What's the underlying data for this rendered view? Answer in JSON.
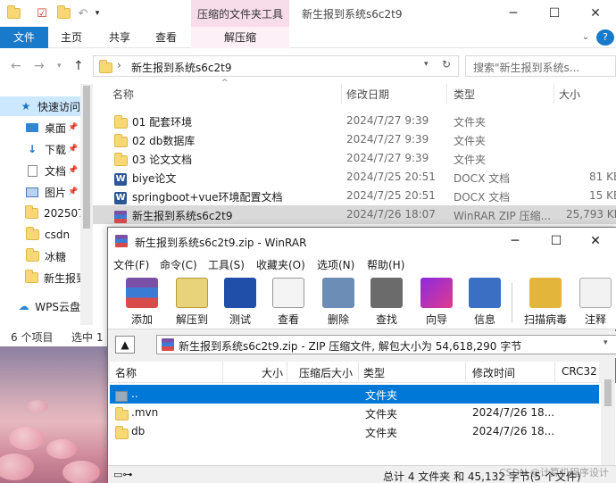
{
  "explorer": {
    "title": "新生报到系统s6c2t9",
    "context_tab": "压缩的文件夹工具",
    "ribbon_tabs": [
      "文件",
      "主页",
      "共享",
      "查看",
      "解压缩"
    ],
    "address": "新生报到系统s6c2t9",
    "search_placeholder": "搜索\"新生报到系统s...",
    "columns": [
      "名称",
      "修改日期",
      "类型",
      "大小"
    ],
    "nav_items": [
      {
        "label": "快速访问",
        "icon": "star-icon"
      },
      {
        "label": "桌面",
        "icon": "desktop-icon"
      },
      {
        "label": "下载",
        "icon": "download-icon"
      },
      {
        "label": "文档",
        "icon": "document-icon"
      },
      {
        "label": "图片",
        "icon": "picture-icon"
      },
      {
        "label": "202507",
        "icon": "folder-icon"
      },
      {
        "label": "csdn",
        "icon": "folder-icon"
      },
      {
        "label": "冰糖",
        "icon": "folder-icon"
      },
      {
        "label": "新生报到",
        "icon": "folder-icon"
      },
      {
        "label": "WPS云盘",
        "icon": "cloud-icon"
      }
    ],
    "files": [
      {
        "name": "01 配套环境",
        "date": "2024/7/27 9:39",
        "type": "文件夹",
        "size": "",
        "icon": "folder-icon"
      },
      {
        "name": "02 db数据库",
        "date": "2024/7/27 9:39",
        "type": "文件夹",
        "size": "",
        "icon": "folder-icon"
      },
      {
        "name": "03 论文文档",
        "date": "2024/7/27 9:39",
        "type": "文件夹",
        "size": "",
        "icon": "folder-icon"
      },
      {
        "name": "biye论文",
        "date": "2024/7/25 20:51",
        "type": "DOCX 文档",
        "size": "81 KB",
        "icon": "word-icon"
      },
      {
        "name": "springboot+vue环境配置文档",
        "date": "2024/7/25 20:51",
        "type": "DOCX 文档",
        "size": "15 KB",
        "icon": "word-icon"
      },
      {
        "name": "新生报到系统s6c2t9",
        "date": "2024/7/26 18:07",
        "type": "WinRAR ZIP 压缩...",
        "size": "25,793 KB",
        "icon": "rar-icon"
      }
    ],
    "status": {
      "count": "6 个项目",
      "selected": "选中 1"
    }
  },
  "winrar": {
    "title": "新生报到系统s6c2t9.zip - WinRAR",
    "menu": [
      "文件(F)",
      "命令(C)",
      "工具(S)",
      "收藏夹(O)",
      "选项(N)",
      "帮助(H)"
    ],
    "tools": [
      {
        "label": "添加",
        "icon": "add-archive-icon"
      },
      {
        "label": "解压到",
        "icon": "extract-to-icon"
      },
      {
        "label": "测试",
        "icon": "test-icon"
      },
      {
        "label": "查看",
        "icon": "view-icon"
      },
      {
        "label": "删除",
        "icon": "delete-icon"
      },
      {
        "label": "查找",
        "icon": "find-icon"
      },
      {
        "label": "向导",
        "icon": "wizard-icon"
      },
      {
        "label": "信息",
        "icon": "info-icon"
      },
      {
        "label": "扫描病毒",
        "icon": "virus-scan-icon"
      },
      {
        "label": "注释",
        "icon": "comment-icon"
      }
    ],
    "path": "新生报到系统s6c2t9.zip - ZIP 压缩文件, 解包大小为 54,618,290 字节",
    "columns": [
      "名称",
      "大小",
      "压缩后大小",
      "类型",
      "修改时间",
      "CRC32"
    ],
    "rows": [
      {
        "name": "..",
        "type": "文件夹",
        "mtime": ""
      },
      {
        "name": ".mvn",
        "type": "文件夹",
        "mtime": "2024/7/26 18..."
      },
      {
        "name": "db",
        "type": "文件夹",
        "mtime": "2024/7/26 18..."
      }
    ],
    "status": "总计 4 文件夹 和 45,132 字节(5 个文件)",
    "watermark": "CSDN @计算机程序设计"
  }
}
